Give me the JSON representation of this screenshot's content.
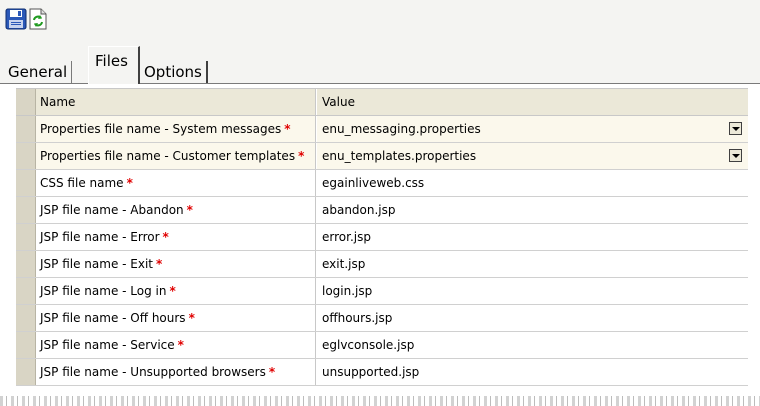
{
  "toolbar": {
    "buttons": [
      {
        "icon": "save-icon"
      },
      {
        "icon": "refresh-icon"
      }
    ]
  },
  "tabs": [
    {
      "label": "General",
      "active": false
    },
    {
      "label": "Files",
      "active": true
    },
    {
      "label": "Options",
      "active": false
    }
  ],
  "grid": {
    "columns": [
      "Name",
      "Value"
    ],
    "required_marker": "*",
    "rows": [
      {
        "name": "Properties file name - System messages",
        "value": "enu_messaging.properties",
        "dropdown": true
      },
      {
        "name": "Properties file name - Customer templates",
        "value": "enu_templates.properties",
        "dropdown": true
      },
      {
        "name": "CSS file name",
        "value": "egainliveweb.css",
        "dropdown": false
      },
      {
        "name": "JSP file name - Abandon",
        "value": "abandon.jsp",
        "dropdown": false
      },
      {
        "name": "JSP file name - Error",
        "value": "error.jsp",
        "dropdown": false
      },
      {
        "name": "JSP file name - Exit",
        "value": "exit.jsp",
        "dropdown": false
      },
      {
        "name": "JSP file name - Log in",
        "value": "login.jsp",
        "dropdown": false
      },
      {
        "name": "JSP file name - Off hours",
        "value": "offhours.jsp",
        "dropdown": false
      },
      {
        "name": "JSP file name - Service",
        "value": "eglvconsole.jsp",
        "dropdown": false
      },
      {
        "name": "JSP file name - Unsupported browsers",
        "value": "unsupported.jsp",
        "dropdown": false
      }
    ]
  },
  "colors": {
    "required": "#e00000",
    "header_bg": "#ebe8d8",
    "row_highlight": "#fbf8ec",
    "row_stub": "#d9d5c5"
  }
}
